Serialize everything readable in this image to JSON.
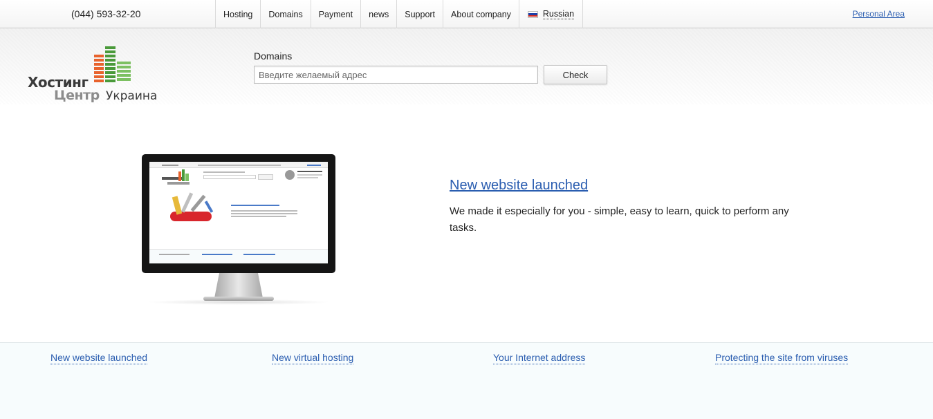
{
  "topbar": {
    "phone": "(044) 593-32-20",
    "nav": [
      "Hosting",
      "Domains",
      "Payment",
      "news",
      "Support",
      "About company"
    ],
    "language": "Russian",
    "language_icon": "russia-flag-icon",
    "personal_area": "Personal Area"
  },
  "logo": {
    "line1": "Хостинг",
    "line2": "Центр",
    "line3": "Украина",
    "icon": "buildings-logo-icon"
  },
  "domain_search": {
    "label": "Domains",
    "placeholder": "Введите желаемый адрес",
    "value": "",
    "button": "Check"
  },
  "hero": {
    "title": "New website launched",
    "text": "We made it especially for you - simple, easy to learn, quick to perform any tasks.",
    "image": "monitor-screenshot"
  },
  "footer": {
    "links": [
      "New website launched",
      "New virtual hosting",
      "Your Internet address",
      "Protecting the site from viruses"
    ]
  },
  "colors": {
    "link": "#2a5db0",
    "logo_orange": "#e8622c",
    "logo_green": "#4a9a3a",
    "footer_bg": "#f7fcfd"
  }
}
